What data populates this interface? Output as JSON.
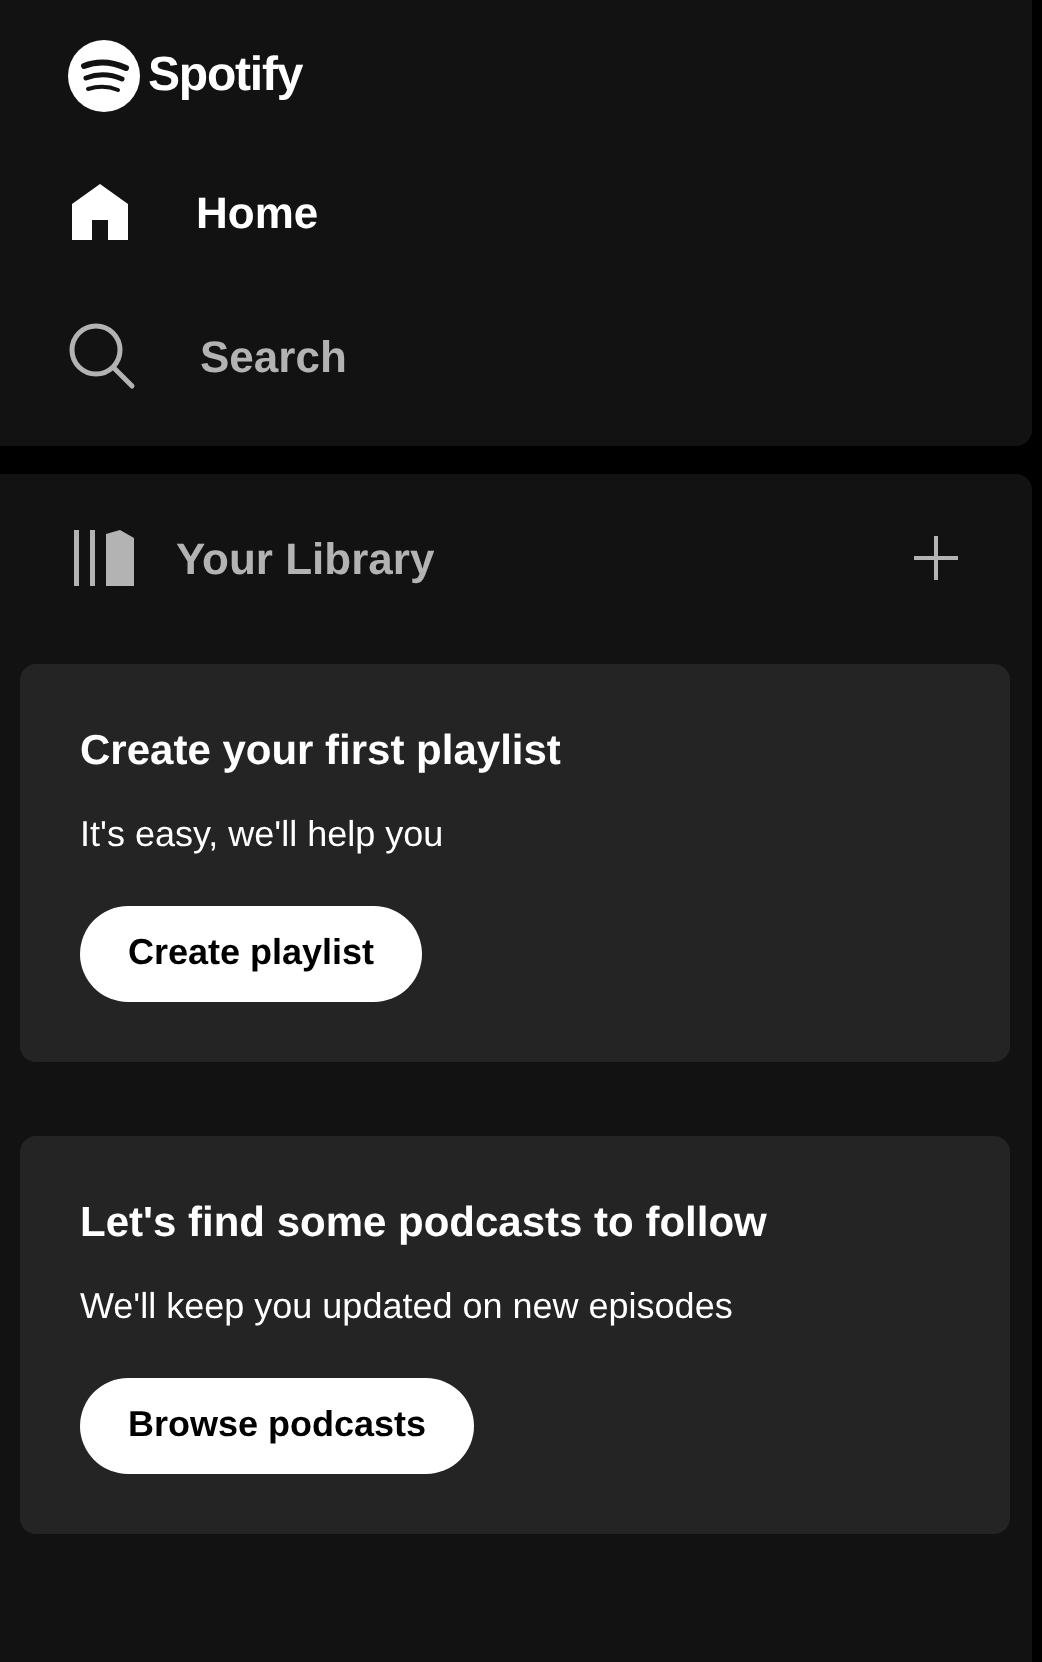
{
  "logo": {
    "text": "Spotify"
  },
  "nav": [
    {
      "label": "Home",
      "kind": "home",
      "selected": true
    },
    {
      "label": "Search",
      "kind": "search",
      "selected": false
    }
  ],
  "library": {
    "title": "Your Library"
  },
  "cards": [
    {
      "title": "Create your first playlist",
      "subtitle": "It's easy, we'll help you",
      "button": "Create playlist"
    },
    {
      "title": "Let's find some podcasts to follow",
      "subtitle": "We'll keep you updated on new episodes",
      "button": "Browse podcasts"
    }
  ]
}
